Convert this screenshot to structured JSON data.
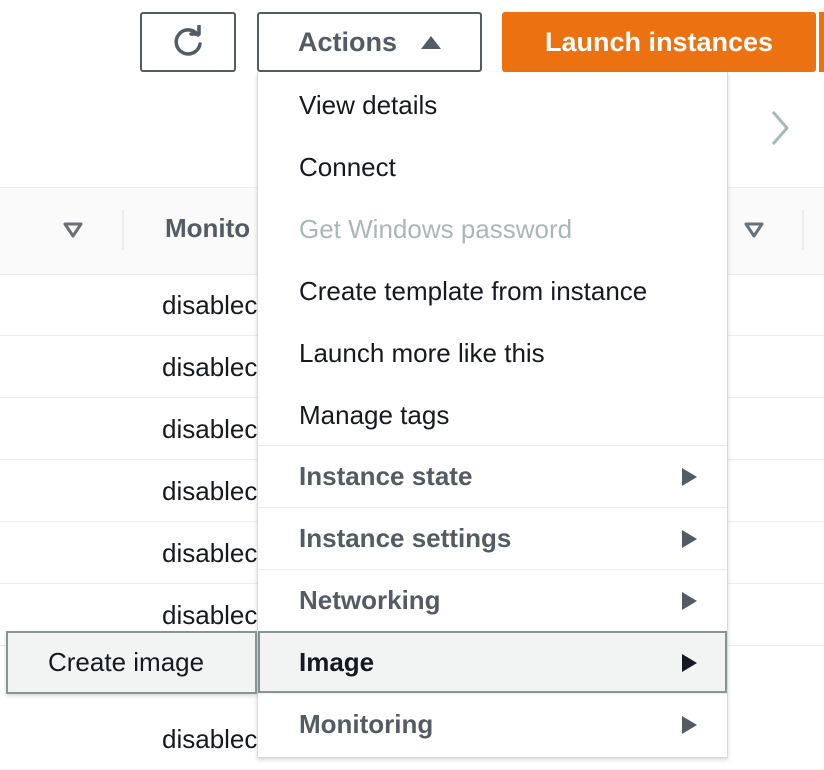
{
  "toolbar": {
    "refresh_icon": "refresh-icon",
    "actions_label": "Actions",
    "launch_label": "Launch instances",
    "accent_color": "#ec7211"
  },
  "table": {
    "monitoring_header": "Monito",
    "rows": [
      "disablec",
      "disablec",
      "disablec",
      "disablec",
      "disablec",
      "disablec",
      "disablec"
    ]
  },
  "actions_menu": {
    "items": [
      {
        "label": "View details",
        "disabled": false
      },
      {
        "label": "Connect",
        "disabled": false
      },
      {
        "label": "Get Windows password",
        "disabled": true
      },
      {
        "label": "Create template from instance",
        "disabled": false
      },
      {
        "label": "Launch more like this",
        "disabled": false
      },
      {
        "label": "Manage tags",
        "disabled": false
      }
    ],
    "groups": [
      {
        "label": "Instance state"
      },
      {
        "label": "Instance settings"
      },
      {
        "label": "Networking"
      },
      {
        "label": "Image",
        "highlighted": true
      },
      {
        "label": "Monitoring"
      }
    ]
  },
  "submenu": {
    "items": [
      "Create image"
    ]
  }
}
